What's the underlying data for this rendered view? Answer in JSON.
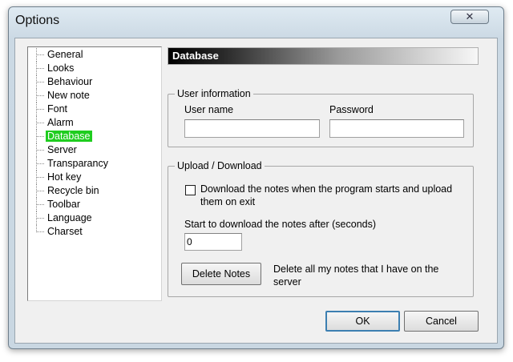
{
  "window": {
    "title": "Options",
    "close_symbol": "✕"
  },
  "tree": {
    "items": [
      "General",
      "Looks",
      "Behaviour",
      "New note",
      "Font",
      "Alarm",
      "Database",
      "Server",
      "Transparancy",
      "Hot key",
      "Recycle bin",
      "Toolbar",
      "Language",
      "Charset"
    ],
    "selected": "Database"
  },
  "panel": {
    "header": "Database"
  },
  "user_info": {
    "group_label": "User information",
    "username_label": "User name",
    "username_value": "",
    "password_label": "Password",
    "password_value": ""
  },
  "upload": {
    "group_label": "Upload / Download",
    "checkbox_label_line1": "Download the notes when the program starts and upload",
    "checkbox_label_line2": "them on exit",
    "checkbox_checked": false,
    "delay_label": "Start to download the notes after (seconds)",
    "delay_value": "0",
    "delete_button": "Delete Notes",
    "delete_desc_line1": "Delete all my notes that I have on the",
    "delete_desc_line2": "server"
  },
  "buttons": {
    "ok": "OK",
    "cancel": "Cancel"
  }
}
